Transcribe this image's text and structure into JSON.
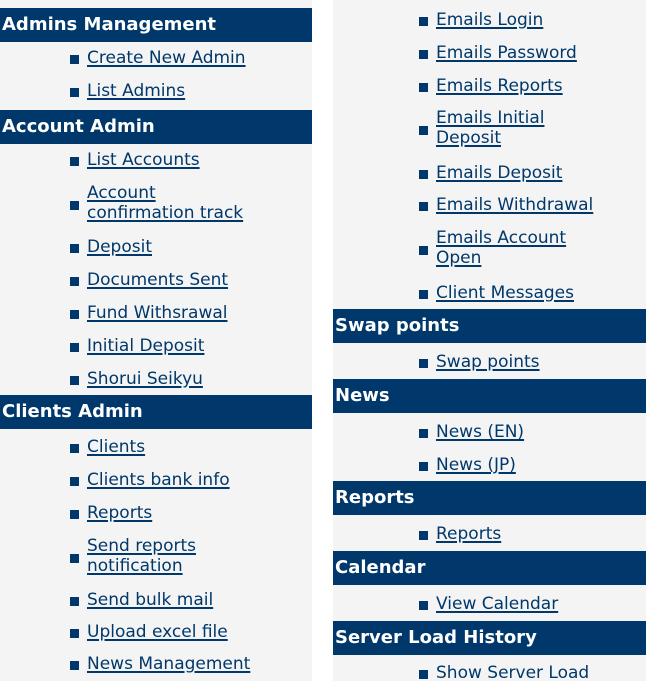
{
  "left_column": {
    "sections": [
      {
        "title": "Admins Management",
        "items": [
          "Create New Admin",
          "List Admins"
        ]
      },
      {
        "title": "Account Admin",
        "items": [
          "List Accounts",
          "Account\nconfirmation track",
          "Deposit",
          "Documents Sent",
          "Fund Withsrawal",
          "Initial Deposit",
          "Shorui Seikyu"
        ]
      },
      {
        "title": "Clients Admin",
        "items": [
          "Clients",
          "Clients bank info",
          "Reports",
          "Send reports\nnotification",
          "Send bulk mail",
          "Upload excel file",
          "News Management"
        ]
      }
    ]
  },
  "right_column": {
    "sections": [
      {
        "title": "",
        "items": [
          "Emails Login",
          "Emails Password",
          "Emails Reports",
          "Emails Initial\nDeposit",
          "Emails Deposit",
          "Emails Withdrawal",
          "Emails Account\nOpen",
          "Client Messages"
        ]
      },
      {
        "title": "Swap points",
        "items": [
          "Swap points"
        ]
      },
      {
        "title": "News",
        "items": [
          "News (EN)",
          "News (JP)"
        ]
      },
      {
        "title": "Reports",
        "items": [
          "Reports"
        ]
      },
      {
        "title": "Calendar",
        "items": [
          "View Calendar"
        ]
      },
      {
        "title": "Server Load History",
        "items": [
          "Show Server Load"
        ]
      }
    ]
  },
  "colors": {
    "header_bg": "#00386b",
    "header_text": "#ffffff",
    "link": "#00386b",
    "panel_bg": "#f4f4f4"
  }
}
